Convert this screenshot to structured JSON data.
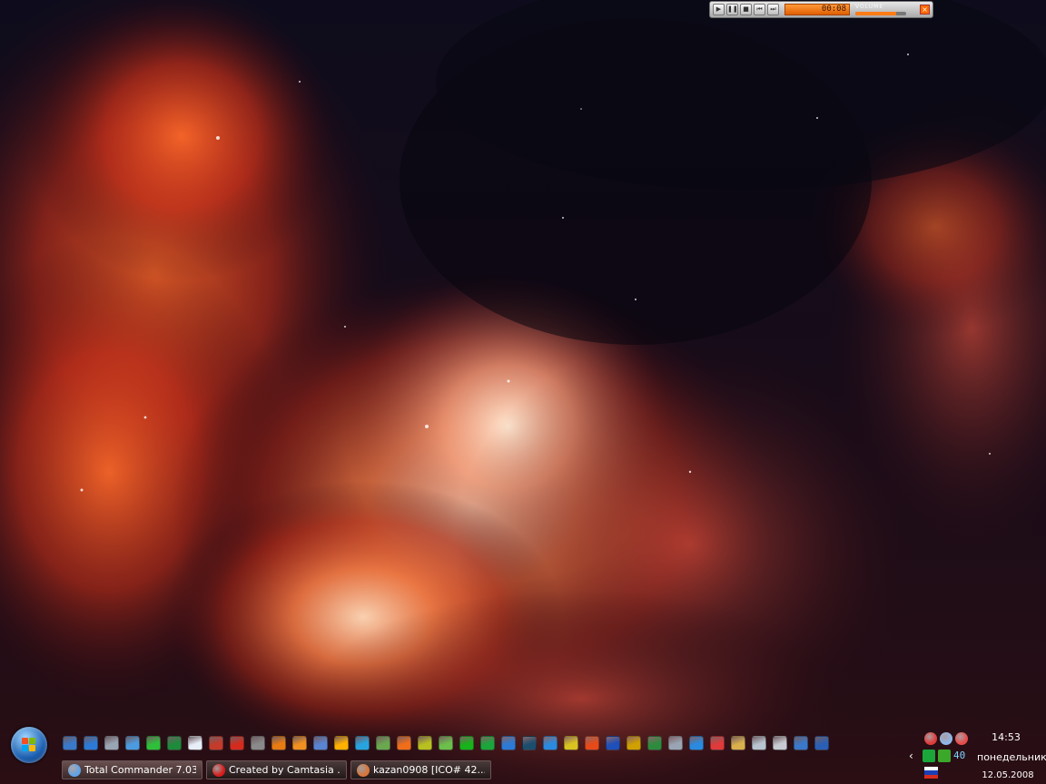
{
  "player": {
    "time": "00:08",
    "volume_label": "VOLUME",
    "volume_level": 0.8,
    "buttons": [
      {
        "icon": "play-icon",
        "glyph": "▶"
      },
      {
        "icon": "pause-icon",
        "glyph": "❚❚"
      },
      {
        "icon": "stop-icon",
        "glyph": "■"
      },
      {
        "icon": "previous-icon",
        "glyph": "⏮"
      },
      {
        "icon": "next-icon",
        "glyph": "⏭"
      }
    ],
    "close_glyph": "×",
    "accent": "#ff7b16"
  },
  "start_button": {
    "icon": "windows-orb-icon"
  },
  "quick_launch": [
    {
      "icon": "show-desktop-icon",
      "color": "#3a78c9"
    },
    {
      "icon": "network-icon",
      "color": "#2c7ad6"
    },
    {
      "icon": "calculator-icon",
      "color": "#9aa5b4"
    },
    {
      "icon": "document-icon",
      "color": "#4c9be0"
    },
    {
      "icon": "hash-icon",
      "color": "#2fbf3a"
    },
    {
      "icon": "excel-icon",
      "color": "#1e8a3c"
    },
    {
      "icon": "word-icon",
      "color": "#e8eef8"
    },
    {
      "icon": "uninstall-icon",
      "color": "#c43b2b"
    },
    {
      "icon": "acrobat-icon",
      "color": "#d42b1e"
    },
    {
      "icon": "tools-icon",
      "color": "#8a8a8a"
    },
    {
      "icon": "daemon-icon",
      "color": "#e87a12"
    },
    {
      "icon": "office-icon",
      "color": "#f09020"
    },
    {
      "icon": "link-icon",
      "color": "#5a83d1"
    },
    {
      "icon": "alcohol-icon",
      "color": "#ffb000"
    },
    {
      "icon": "drive-icon",
      "color": "#27a4e0"
    },
    {
      "icon": "pencil-icon",
      "color": "#6aa84f"
    },
    {
      "icon": "firefox-icon",
      "color": "#f06d1a"
    },
    {
      "icon": "puzzle-icon",
      "color": "#b8c020"
    },
    {
      "icon": "battery-icon",
      "color": "#6bbf4a"
    },
    {
      "icon": "play-green-icon",
      "color": "#18b21a"
    },
    {
      "icon": "icq-icon",
      "color": "#1aa63a"
    },
    {
      "icon": "network-2-icon",
      "color": "#2c7ad6"
    },
    {
      "icon": "nero-icon",
      "color": "#1d4d6d"
    },
    {
      "icon": "ie-icon",
      "color": "#2a8ae0"
    },
    {
      "icon": "cd-icon",
      "color": "#d8c320"
    },
    {
      "icon": "burn-icon",
      "color": "#e64a19"
    },
    {
      "icon": "bluetooth-icon",
      "color": "#1f4fb8"
    },
    {
      "icon": "pin-icon",
      "color": "#d0a000"
    },
    {
      "icon": "notepad-icon",
      "color": "#2e8b3e"
    },
    {
      "icon": "chart-icon",
      "color": "#9aa5b4"
    },
    {
      "icon": "globe-icon",
      "color": "#2a8ae0"
    },
    {
      "icon": "lifebuoy-icon",
      "color": "#e03a3a"
    },
    {
      "icon": "people-icon",
      "color": "#d9b04c"
    },
    {
      "icon": "recycle-bin-icon",
      "color": "#b8c4cf"
    },
    {
      "icon": "printer-icon",
      "color": "#c8ccd2"
    },
    {
      "icon": "computer-icon",
      "color": "#3a78c9"
    },
    {
      "icon": "floppy-icon",
      "color": "#2b5fb5"
    }
  ],
  "tasks": [
    {
      "label": "Total Commander 7.03...",
      "icon": "total-commander-icon",
      "color": "#5fa3e8"
    },
    {
      "label": "Created by Camtasia ...",
      "icon": "opera-icon",
      "color": "#d81c1c"
    },
    {
      "label": "kazan0908   [ICO# 42...",
      "icon": "image-viewer-icon",
      "color": "#d9763a"
    }
  ],
  "tray": {
    "top_icons": [
      {
        "icon": "antivirus-icon",
        "color": "#e03a3a"
      },
      {
        "icon": "sphere-icon",
        "color": "#8fb6e8"
      },
      {
        "icon": "at-icon",
        "color": "#e84a4a"
      }
    ],
    "row_icons": [
      {
        "icon": "icq-tray-icon",
        "color": "#1aa63a"
      },
      {
        "icon": "mascot-icon",
        "color": "#3ba82a"
      }
    ],
    "counter": "40",
    "expand_glyph": "‹",
    "language_icon": "russian-flag-icon"
  },
  "clock": {
    "time": "14:53",
    "day": "понедельник",
    "date": "12.05.2008"
  }
}
